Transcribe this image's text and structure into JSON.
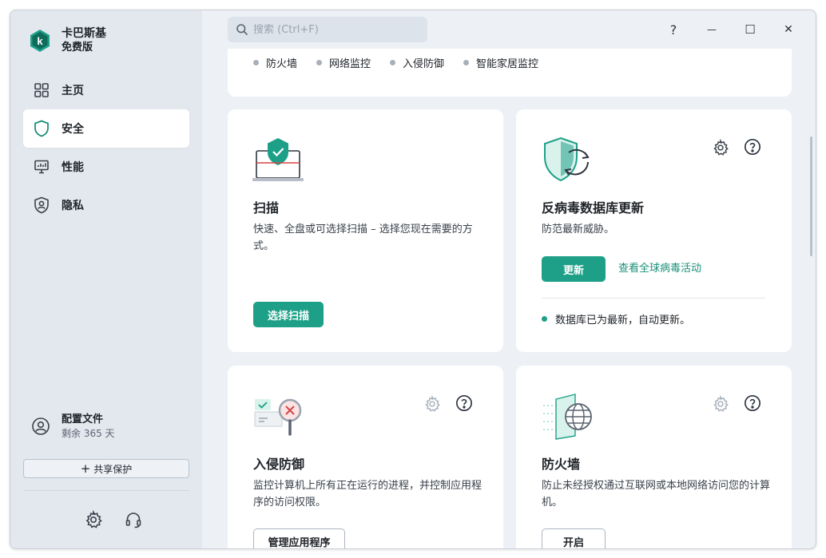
{
  "app": {
    "name": "卡巴斯基",
    "edition": "免费版",
    "brand_color": "#1ea088"
  },
  "search": {
    "placeholder": "搜索 (Ctrl+F)",
    "value": ""
  },
  "window_controls": {
    "help": "?",
    "minimize": "—",
    "maximize": "☐",
    "close": "✕"
  },
  "sidebar": {
    "items": [
      {
        "label": "主页",
        "icon": "home-grid-icon",
        "active": false
      },
      {
        "label": "安全",
        "icon": "shield-icon",
        "active": true
      },
      {
        "label": "性能",
        "icon": "monitor-icon",
        "active": false
      },
      {
        "label": "隐私",
        "icon": "privacy-shield-icon",
        "active": false
      }
    ],
    "profile": {
      "title": "配置文件",
      "subtitle": "剩余 365 天"
    },
    "share_button": "共享保护"
  },
  "features": [
    "防火墙",
    "网络监控",
    "入侵防御",
    "智能家居监控"
  ],
  "cards": {
    "scan": {
      "title": "扫描",
      "desc": "快速、全盘或可选择扫描 – 选择您现在需要的方式。",
      "button": "选择扫描"
    },
    "update": {
      "title": "反病毒数据库更新",
      "desc": "防范最新威胁。",
      "button": "更新",
      "link": "查看全球病毒活动",
      "status": "数据库已为最新，自动更新。"
    },
    "intrusion": {
      "title": "入侵防御",
      "desc": "监控计算机上所有正在运行的进程，并控制应用程序的访问权限。",
      "button": "管理应用程序"
    },
    "firewall": {
      "title": "防火墙",
      "desc": "防止未经授权通过互联网或本地网络访问您的计算机。",
      "button": "开启"
    }
  }
}
